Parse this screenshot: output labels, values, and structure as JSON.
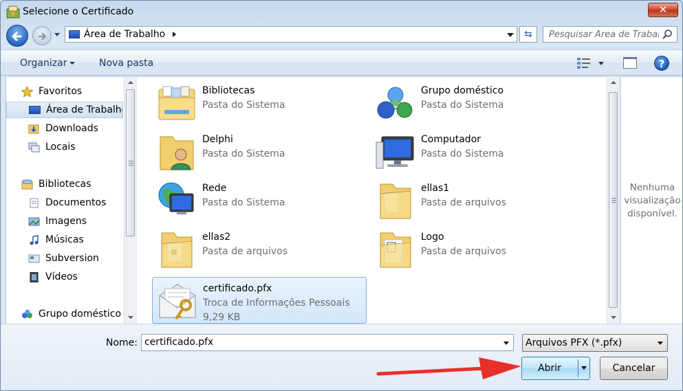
{
  "window": {
    "title": "Selecione o Certificado",
    "close_symbol": "✕"
  },
  "address": {
    "path": "Área de Trabalho"
  },
  "search": {
    "placeholder": "Pesquisar Área de Trabalho"
  },
  "toolbar": {
    "organize_label": "Organizar",
    "new_folder_label": "Nova pasta",
    "help_symbol": "?"
  },
  "nav": {
    "favorites": "Favoritos",
    "desktop": "Área de Trabalho",
    "downloads": "Downloads",
    "places": "Locais",
    "libraries": "Bibliotecas",
    "documents": "Documentos",
    "images": "Imagens",
    "music": "Músicas",
    "subversion": "Subversion",
    "videos": "Vídeos",
    "homegroup": "Grupo doméstico"
  },
  "items": [
    {
      "name": "Bibliotecas",
      "type": "Pasta do Sistema",
      "icon": "libraries-icon"
    },
    {
      "name": "Grupo doméstico",
      "type": "Pasta do Sistema",
      "icon": "homegroup-icon"
    },
    {
      "name": "Delphi",
      "type": "Pasta do Sistema",
      "icon": "user-folder-icon"
    },
    {
      "name": "Computador",
      "type": "Pasta do Sistema",
      "icon": "computer-icon"
    },
    {
      "name": "Rede",
      "type": "Pasta do Sistema",
      "icon": "network-icon"
    },
    {
      "name": "ellas1",
      "type": "Pasta de arquivos",
      "icon": "folder-icon"
    },
    {
      "name": "ellas2",
      "type": "Pasta de arquivos",
      "icon": "folder-icon"
    },
    {
      "name": "Logo",
      "type": "Pasta de arquivos",
      "icon": "folder-icon"
    },
    {
      "name": "certificado.pfx",
      "type": "Troca de Informações Pessoais",
      "size": "9,29 KB",
      "icon": "certificate-icon",
      "selected": true
    }
  ],
  "preview": {
    "text": "Nenhuma visualização disponível."
  },
  "footer": {
    "name_label": "Nome:",
    "file_name": "certificado.pfx",
    "filter": "Arquivos PFX (*.pfx)",
    "open_label": "Abrir",
    "cancel_label": "Cancelar"
  },
  "colors": {
    "annotation_arrow": "#e8302a",
    "selection": "#d3e6fa"
  }
}
